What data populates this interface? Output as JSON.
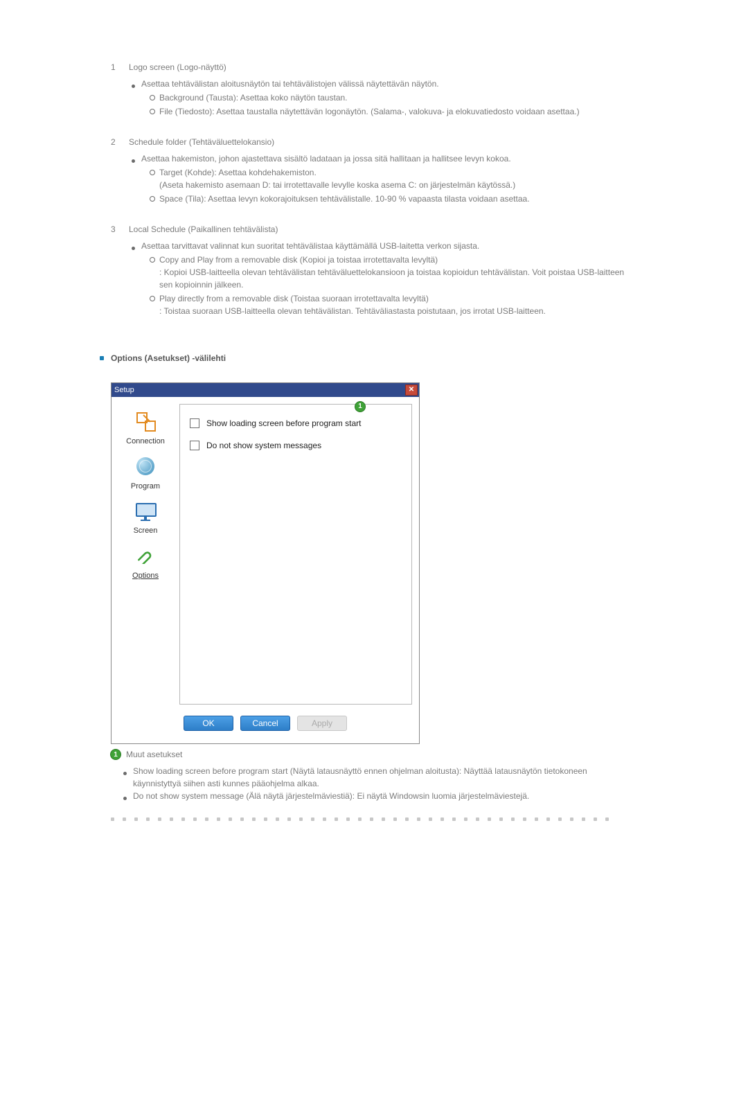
{
  "sections": [
    {
      "num": "1",
      "title": "Logo screen (Logo-näyttö)",
      "points": [
        {
          "text": "Asettaa tehtävälistan aloitusnäytön tai tehtävälistojen välissä näytettävän näytön.",
          "subs": [
            {
              "text": "Background (Tausta): Asettaa koko näytön taustan."
            },
            {
              "text": "File (Tiedosto): Asettaa taustalla näytettävän logonäytön. (Salama-, valokuva- ja elokuvatiedosto voidaan asettaa.)"
            }
          ]
        }
      ]
    },
    {
      "num": "2",
      "title": "Schedule folder (Tehtäväluettelokansio)",
      "points": [
        {
          "text": "Asettaa hakemiston, johon ajastettava sisältö ladataan ja jossa sitä hallitaan ja hallitsee levyn kokoa.",
          "subs": [
            {
              "text": "Target (Kohde): Asettaa kohdehakemiston.",
              "cont": "(Aseta hakemisto asemaan D: tai irrotettavalle levylle koska asema C: on järjestelmän käytössä.)"
            },
            {
              "text": "Space (Tila): Asettaa levyn kokorajoituksen tehtävälistalle. 10-90 % vapaasta tilasta voidaan asettaa."
            }
          ]
        }
      ]
    },
    {
      "num": "3",
      "title": "Local Schedule (Paikallinen tehtävälista)",
      "points": [
        {
          "text": "Asettaa tarvittavat valinnat kun suoritat tehtävälistaa käyttämällä USB-laitetta verkon sijasta.",
          "subs": [
            {
              "text": "Copy and Play from a removable disk (Kopioi ja toistaa irrotettavalta levyltä)",
              "cont": ": Kopioi USB-laitteella olevan tehtävälistan tehtäväluettelokansioon ja toistaa kopioidun tehtävälistan. Voit poistaa USB-laitteen sen kopioinnin jälkeen."
            },
            {
              "text": "Play directly from a removable disk (Toistaa suoraan irrotettavalta levyltä)",
              "cont": ": Toistaa suoraan USB-laitteella olevan tehtävälistan. Tehtäväliastasta poistutaan, jos irrotat USB-laitteen."
            }
          ]
        }
      ]
    }
  ],
  "options_header": "Options (Asetukset) -välilehti",
  "dialog": {
    "title": "Setup",
    "callout_num": "1",
    "nav": [
      {
        "label": "Connection"
      },
      {
        "label": "Program"
      },
      {
        "label": "Screen"
      },
      {
        "label": "Options",
        "underline": true
      }
    ],
    "checks": [
      {
        "label": "Show loading screen before program start"
      },
      {
        "label": "Do not show system messages"
      }
    ],
    "buttons": {
      "ok": "OK",
      "cancel": "Cancel",
      "apply": "Apply"
    }
  },
  "after": {
    "badge": "1",
    "title": "Muut asetukset",
    "items": [
      "Show loading screen before program start (Näytä latausnäyttö ennen ohjelman aloitusta): Näyttää latausnäytön tietokoneen käynnistyttyä siihen asti kunnes pääohjelma alkaa.",
      "Do not show system message (Älä näytä järjestelmäviestiä): Ei näytä Windowsin luomia järjestelmäviestejä."
    ]
  }
}
